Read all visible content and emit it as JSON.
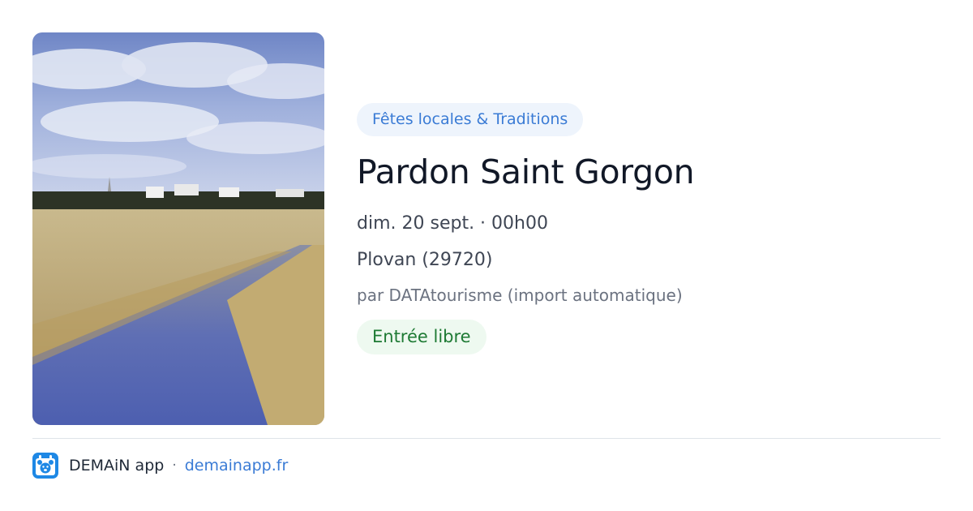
{
  "event": {
    "category": "Fêtes locales & Traditions",
    "title": "Pardon Saint Gorgon",
    "datetime": "dim. 20 sept. · 00h00",
    "location": "Plovan (29720)",
    "organizer": "par DATAtourisme (import automatique)",
    "price": "Entrée libre",
    "image": "landscape-photo-canal-reeds-village"
  },
  "footer": {
    "logo_icon": "calendar-bear-logo-icon",
    "app_name": "DEMAiN app",
    "separator": "·",
    "link_text": "demainapp.fr"
  },
  "colors": {
    "accent_blue": "#3a7bd5",
    "category_bg": "#eef4fc",
    "price_green": "#1e7a34",
    "price_bg": "#eef9f0",
    "title_text": "#111827"
  }
}
